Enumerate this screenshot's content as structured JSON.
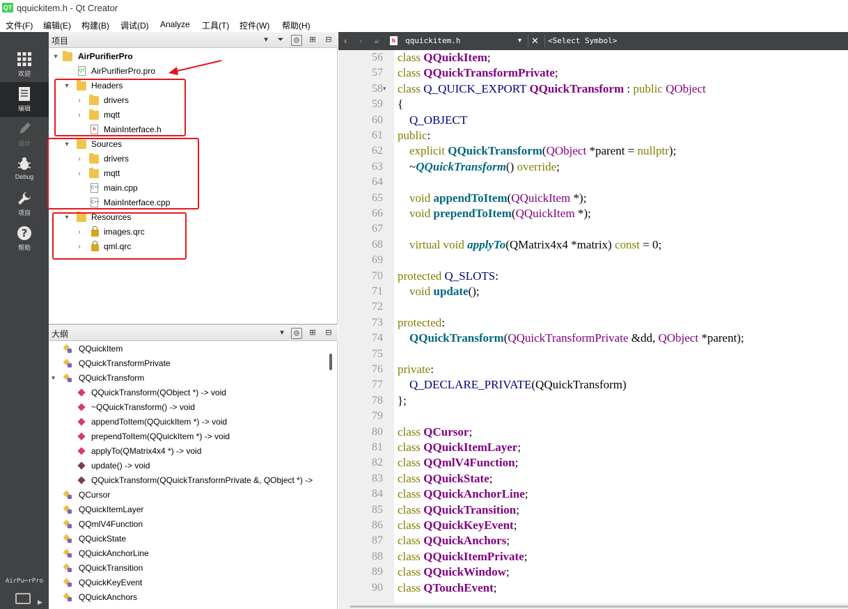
{
  "window": {
    "app_icon_text": "QT",
    "title": "qquickitem.h - Qt Creator"
  },
  "menu": [
    {
      "label": "文件(F)"
    },
    {
      "label": "编辑(E)"
    },
    {
      "label": "构建(B)"
    },
    {
      "label": "调试(D)"
    },
    {
      "label": "Analyze"
    },
    {
      "label": "工具(T)"
    },
    {
      "label": "控件(W)"
    },
    {
      "label": "帮助(H)"
    }
  ],
  "modes": [
    {
      "label": "欢迎",
      "icon": "grid-icon"
    },
    {
      "label": "编辑",
      "icon": "edit-doc-icon"
    },
    {
      "label": "设计",
      "icon": "pen-icon"
    },
    {
      "label": "Debug",
      "icon": "bug-icon"
    },
    {
      "label": "项目",
      "icon": "wrench-icon"
    },
    {
      "label": "帮助",
      "icon": "help-icon"
    }
  ],
  "bottom_project": "AirPu⋯rPro",
  "project_panel": {
    "title": "项目"
  },
  "project_tree": {
    "root": "AirPurifierPro",
    "pro_file": "AirPurifierPro.pro",
    "headers": {
      "label": "Headers",
      "children": [
        "drivers",
        "mqtt",
        "MainInterface.h"
      ]
    },
    "sources": {
      "label": "Sources",
      "children": [
        "drivers",
        "mqtt",
        "main.cpp",
        "MainInterface.cpp"
      ]
    },
    "resources": {
      "label": "Resources",
      "children": [
        "images.qrc",
        "qml.qrc"
      ]
    },
    "icon_texts": {
      "pro": "QT",
      "h": "h",
      "cpp": "C++"
    }
  },
  "outline_panel": {
    "title": "大纲"
  },
  "outline": [
    {
      "text": "QQuickItem",
      "kind": "class",
      "indent": 0
    },
    {
      "text": "QQuickTransformPrivate",
      "kind": "class",
      "indent": 0
    },
    {
      "text": "QQuickTransform",
      "kind": "class",
      "indent": 0,
      "expanded": true
    },
    {
      "text": "QQuickTransform(QObject *) -> void",
      "kind": "function",
      "indent": 1
    },
    {
      "text": "~QQuickTransform() -> void",
      "kind": "function",
      "indent": 1
    },
    {
      "text": "appendToItem(QQuickItem *) -> void",
      "kind": "function",
      "indent": 1
    },
    {
      "text": "prependToItem(QQuickItem *) -> void",
      "kind": "function",
      "indent": 1
    },
    {
      "text": "applyTo(QMatrix4x4 *) -> void",
      "kind": "function",
      "indent": 1
    },
    {
      "text": "update() -> void",
      "kind": "slot",
      "indent": 1
    },
    {
      "text": "QQuickTransform(QQuickTransformPrivate &, QObject *) ->",
      "kind": "slot",
      "indent": 1
    },
    {
      "text": "QCursor",
      "kind": "class",
      "indent": 0
    },
    {
      "text": "QQuickItemLayer",
      "kind": "class",
      "indent": 0
    },
    {
      "text": "QQmlV4Function",
      "kind": "class",
      "indent": 0
    },
    {
      "text": "QQuickState",
      "kind": "class",
      "indent": 0
    },
    {
      "text": "QQuickAnchorLine",
      "kind": "class",
      "indent": 0
    },
    {
      "text": "QQuickTransition",
      "kind": "class",
      "indent": 0
    },
    {
      "text": "QQuickKeyEvent",
      "kind": "class",
      "indent": 0
    },
    {
      "text": "QQuickAnchors",
      "kind": "class",
      "indent": 0
    }
  ],
  "editor": {
    "file_name": "qquickitem.h",
    "symbol_placeholder": "<Select Symbol>",
    "line_numbers": [
      "56",
      "57",
      "58",
      "59",
      "60",
      "61",
      "62",
      "63",
      "64",
      "65",
      "66",
      "67",
      "68",
      "69",
      "70",
      "71",
      "72",
      "73",
      "74",
      "75",
      "76",
      "77",
      "78",
      "79",
      "80",
      "81",
      "82",
      "83",
      "84",
      "85",
      "86",
      "87",
      "88",
      "89",
      "90"
    ],
    "lines": [
      [
        [
          "class ",
          "kw"
        ],
        [
          "QQuickItem",
          "tyb"
        ],
        [
          ";",
          ""
        ]
      ],
      [
        [
          "class ",
          "kw"
        ],
        [
          "QQuickTransformPrivate",
          "tyb"
        ],
        [
          ";",
          ""
        ]
      ],
      [
        [
          "class ",
          "kw"
        ],
        [
          "Q_QUICK_EXPORT ",
          "mac"
        ],
        [
          "QQuickTransform",
          "tyb"
        ],
        [
          " : ",
          ""
        ],
        [
          "public ",
          "kw"
        ],
        [
          "QObject",
          "ty"
        ]
      ],
      [
        [
          "{",
          ""
        ]
      ],
      [
        [
          "    Q_OBJECT",
          "mac"
        ]
      ],
      [
        [
          "public",
          "kw"
        ],
        [
          ":",
          ""
        ]
      ],
      [
        [
          "    explicit ",
          "kw"
        ],
        [
          "QQuickTransform",
          "fnb"
        ],
        [
          "(",
          ""
        ],
        [
          "QObject",
          "ty"
        ],
        [
          " *parent = ",
          ""
        ],
        [
          "nullptr",
          "kw"
        ],
        [
          ");",
          ""
        ]
      ],
      [
        [
          "    ~",
          ""
        ],
        [
          "QQuickTransform",
          "fni"
        ],
        [
          "() ",
          ""
        ],
        [
          "override",
          "kw"
        ],
        [
          ";",
          ""
        ]
      ],
      [],
      [
        [
          "    void ",
          "kw"
        ],
        [
          "appendToItem",
          "fnb"
        ],
        [
          "(",
          ""
        ],
        [
          "QQuickItem",
          "ty"
        ],
        [
          " *);",
          ""
        ]
      ],
      [
        [
          "    void ",
          "kw"
        ],
        [
          "prependToItem",
          "fnb"
        ],
        [
          "(",
          ""
        ],
        [
          "QQuickItem",
          "ty"
        ],
        [
          " *);",
          ""
        ]
      ],
      [],
      [
        [
          "    virtual ",
          "kw"
        ],
        [
          "void ",
          "kw"
        ],
        [
          "applyTo",
          "fni"
        ],
        [
          "(QMatrix4x4 *matrix) ",
          ""
        ],
        [
          "const",
          "kw"
        ],
        [
          " = 0;",
          ""
        ]
      ],
      [],
      [
        [
          "protected ",
          "kw"
        ],
        [
          "Q_SLOTS",
          "mac"
        ],
        [
          ":",
          ""
        ]
      ],
      [
        [
          "    void ",
          "kw"
        ],
        [
          "update",
          "fnb"
        ],
        [
          "();",
          ""
        ]
      ],
      [],
      [
        [
          "protected",
          "kw"
        ],
        [
          ":",
          ""
        ]
      ],
      [
        [
          "    ",
          ""
        ],
        [
          "QQuickTransform",
          "fnb"
        ],
        [
          "(",
          ""
        ],
        [
          "QQuickTransformPrivate",
          "ty"
        ],
        [
          " &dd, ",
          ""
        ],
        [
          "QObject",
          "ty"
        ],
        [
          " *parent);",
          ""
        ]
      ],
      [],
      [
        [
          "private",
          "kw"
        ],
        [
          ":",
          ""
        ]
      ],
      [
        [
          "    Q_DECLARE_PRIVATE",
          "mac"
        ],
        [
          "(QQuickTransform)",
          ""
        ]
      ],
      [
        [
          "};",
          ""
        ]
      ],
      [],
      [
        [
          "class ",
          "kw"
        ],
        [
          "QCursor",
          "tyb"
        ],
        [
          ";",
          ""
        ]
      ],
      [
        [
          "class ",
          "kw"
        ],
        [
          "QQuickItemLayer",
          "tyb"
        ],
        [
          ";",
          ""
        ]
      ],
      [
        [
          "class ",
          "kw"
        ],
        [
          "QQmlV4Function",
          "tyb"
        ],
        [
          ";",
          ""
        ]
      ],
      [
        [
          "class ",
          "kw"
        ],
        [
          "QQuickState",
          "tyb"
        ],
        [
          ";",
          ""
        ]
      ],
      [
        [
          "class ",
          "kw"
        ],
        [
          "QQuickAnchorLine",
          "tyb"
        ],
        [
          ";",
          ""
        ]
      ],
      [
        [
          "class ",
          "kw"
        ],
        [
          "QQuickTransition",
          "tyb"
        ],
        [
          ";",
          ""
        ]
      ],
      [
        [
          "class ",
          "kw"
        ],
        [
          "QQuickKeyEvent",
          "tyb"
        ],
        [
          ";",
          ""
        ]
      ],
      [
        [
          "class ",
          "kw"
        ],
        [
          "QQuickAnchors",
          "tyb"
        ],
        [
          ";",
          ""
        ]
      ],
      [
        [
          "class ",
          "kw"
        ],
        [
          "QQuickItemPrivate",
          "tyb"
        ],
        [
          ";",
          ""
        ]
      ],
      [
        [
          "class ",
          "kw"
        ],
        [
          "QQuickWindow",
          "tyb"
        ],
        [
          ";",
          ""
        ]
      ],
      [
        [
          "class ",
          "kw"
        ],
        [
          "QTouchEvent",
          "tyb"
        ],
        [
          ";",
          ""
        ]
      ]
    ]
  },
  "colors": {
    "keyword": "#808000",
    "type": "#800080",
    "function": "#00677c",
    "annotation_red": "#e8151b",
    "sidebar": "#404244"
  }
}
